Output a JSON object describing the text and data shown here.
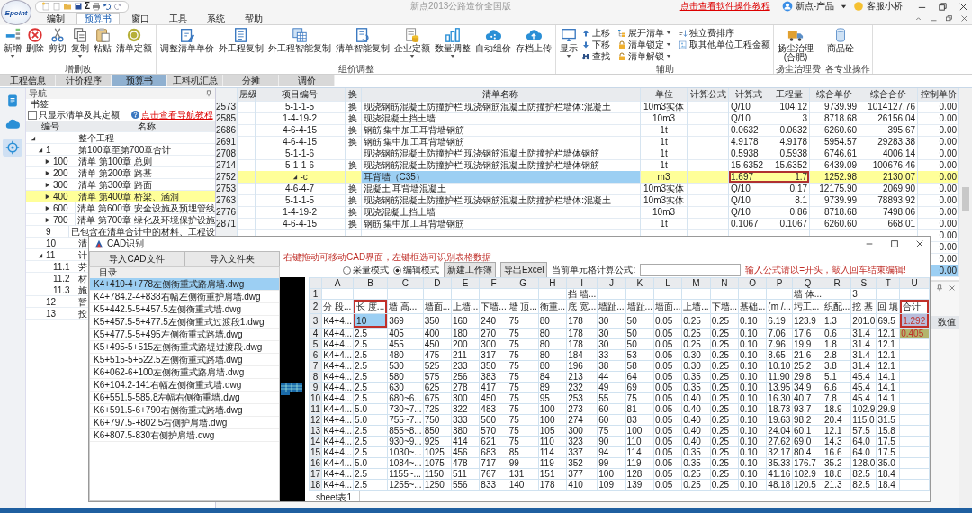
{
  "app": {
    "logo": "Epoint",
    "sum_symbol": "Σ",
    "title": "新点2013公路造价全国版",
    "tutorial_link": "点击查看软件操作教程",
    "user": "新点-产品",
    "support": "客服小桥"
  },
  "menu_tabs": [
    {
      "label": "编制",
      "selected": false
    },
    {
      "label": "预算书",
      "selected": true
    },
    {
      "label": "窗口",
      "selected": false
    },
    {
      "label": "工具",
      "selected": false
    },
    {
      "label": "系统",
      "selected": false
    },
    {
      "label": "帮助",
      "selected": false
    }
  ],
  "ribbon": [
    {
      "label": "增删改",
      "items": [
        {
          "kind": "large",
          "label": "新增",
          "dropdown": true
        },
        {
          "kind": "large",
          "label": "删除",
          "dropdown": false
        },
        {
          "kind": "large",
          "label": "剪切",
          "dropdown": false
        },
        {
          "kind": "large",
          "label": "复制",
          "dropdown": true
        },
        {
          "kind": "large",
          "label": "粘贴",
          "dropdown": false
        },
        {
          "kind": "large",
          "label": "清单定额",
          "dropdown": false
        }
      ]
    },
    {
      "label": "组价调整",
      "items": [
        {
          "kind": "large",
          "label": "调整清单单价",
          "dropdown": false
        },
        {
          "kind": "large",
          "label": "外工程复制",
          "dropdown": false
        },
        {
          "kind": "large",
          "label": "外工程智能复制",
          "dropdown": false
        },
        {
          "kind": "large",
          "label": "清单智能复制",
          "dropdown": false
        },
        {
          "kind": "large",
          "label": "企业定额",
          "dropdown": true
        },
        {
          "kind": "large",
          "label": "数量调整",
          "dropdown": true
        },
        {
          "kind": "large",
          "label": "自动组价",
          "dropdown": false
        },
        {
          "kind": "large",
          "label": "存档上传",
          "dropdown": false
        }
      ]
    },
    {
      "label": "辅助",
      "items": [
        {
          "kind": "large",
          "label": "显示",
          "dropdown": true
        },
        {
          "kind": "small",
          "label": "上移",
          "dropdown": false
        },
        {
          "kind": "small",
          "label": "下移",
          "dropdown": false
        },
        {
          "kind": "small",
          "label": "查找",
          "dropdown": false
        },
        {
          "kind": "small",
          "label": "展开清单",
          "dropdown": true
        },
        {
          "kind": "small",
          "label": "清单锁定",
          "dropdown": true
        },
        {
          "kind": "small",
          "label": "清单解锁",
          "dropdown": true
        },
        {
          "kind": "small",
          "label": "独立费排序",
          "dropdown": false
        },
        {
          "kind": "small",
          "label": "取其他单位工程金额",
          "dropdown": false
        }
      ]
    },
    {
      "label": "扬尘治理费",
      "items": [
        {
          "kind": "large",
          "label": "扬尘治理\n(合肥)",
          "dropdown": false
        }
      ]
    },
    {
      "label": "各专业操作",
      "items": [
        {
          "kind": "large",
          "label": "商品砼",
          "dropdown": false
        }
      ]
    }
  ],
  "page_tabs": [
    {
      "label": "工程信息",
      "selected": false
    },
    {
      "label": "计价程序",
      "selected": false
    },
    {
      "label": "预算书",
      "selected": true
    },
    {
      "label": "工料机汇总",
      "selected": false
    },
    {
      "label": "分摊",
      "selected": false
    },
    {
      "label": "调价",
      "selected": false
    }
  ],
  "side_nav": [
    {
      "selected": false
    },
    {
      "selected": false
    },
    {
      "selected": true
    }
  ],
  "nav": {
    "title": "导航",
    "bookmark": "书签",
    "filter": {
      "label": "只显示清单及其定额",
      "checked": false
    },
    "help_link": "点击查看导航教程",
    "columns": [
      "编号",
      "名称"
    ],
    "tree": [
      {
        "name": "整个工程",
        "expanded": true,
        "selected": false,
        "children": [
          {
            "code": "1",
            "name": "第100章至第700章合计",
            "expanded": true,
            "selected": false,
            "children": [
              {
                "code": "100",
                "name": "清单 第100章 总则",
                "expanded": false,
                "selected": false
              },
              {
                "code": "200",
                "name": "清单 第200章 路基",
                "expanded": false,
                "selected": false
              },
              {
                "code": "300",
                "name": "清单 第300章 路面",
                "expanded": false,
                "selected": false
              },
              {
                "code": "400",
                "name": "清单 第400章 桥梁、涵洞",
                "expanded": false,
                "selected": true
              },
              {
                "code": "600",
                "name": "清单 第600章 安全设施及预埋管线",
                "expanded": false,
                "selected": false
              },
              {
                "code": "700",
                "name": "清单 第700章 绿化及环境保护设施",
                "expanded": false,
                "selected": false
              }
            ]
          },
          {
            "code": "9",
            "name": "已包含在清单合计中的材料、工程设",
            "selected": false
          },
          {
            "code": "10",
            "name": "清",
            "selected": false
          },
          {
            "code": "11",
            "name": "计",
            "expanded": true,
            "selected": false,
            "children": [
              {
                "code": "11.1",
                "name": "劳",
                "selected": false
              },
              {
                "code": "11.2",
                "name": "材",
                "selected": false
              },
              {
                "code": "11.3",
                "name": "施",
                "selected": false
              }
            ]
          },
          {
            "code": "12",
            "name": "暂",
            "selected": false
          },
          {
            "code": "13",
            "name": "投",
            "selected": false
          }
        ]
      }
    ]
  },
  "table": {
    "columns": [
      "层级",
      "项目编号",
      "换",
      "清单名称",
      "单位",
      "计算公式",
      "计算式",
      "工程量",
      "综合单价",
      "综合合价",
      "控制单价"
    ],
    "rows": [
      {
        "num": "2573",
        "kind": "quota",
        "code": "5-1-1-5",
        "swap": "换",
        "name": "现浇钢筋混凝土防撞护栏 现浇钢筋混凝土防撞护栏墙体:混凝土",
        "unit": "10m3实体",
        "calc": "Q/10",
        "qty": "104.12",
        "price": "9739.99",
        "total": "1014127.76",
        "control": "0.00",
        "selected": false
      },
      {
        "num": "2585",
        "kind": "quota",
        "code": "1-4-19-2",
        "swap": "换",
        "name": "现浇混凝土挡土墙",
        "unit": "10m3",
        "calc": "Q/10",
        "qty": "3",
        "price": "8718.68",
        "total": "26156.04",
        "control": "0.00",
        "selected": false
      },
      {
        "num": "2686",
        "kind": "quota",
        "code": "4-6-4-15",
        "swap": "换",
        "name": "钢筋 集中加工耳背墙钢筋",
        "unit": "1t",
        "calc": "0.0632",
        "qty": "0.0632",
        "price": "6260.60",
        "total": "395.67",
        "control": "0.00",
        "selected": false
      },
      {
        "num": "2691",
        "kind": "quota",
        "code": "4-6-4-15",
        "swap": "换",
        "name": "钢筋 集中加工耳背墙钢筋",
        "unit": "1t",
        "calc": "4.9178",
        "qty": "4.9178",
        "price": "5954.57",
        "total": "29283.38",
        "control": "0.00",
        "selected": false
      },
      {
        "num": "2708",
        "kind": "quota",
        "code": "5-1-1-6",
        "name": "现浇钢筋混凝土防撞护栏 现浇钢筋混凝土防撞护栏墙体钢筋",
        "unit": "1t",
        "calc": "0.5938",
        "qty": "0.5938",
        "price": "6746.61",
        "total": "4006.14",
        "control": "0.00",
        "selected": false
      },
      {
        "num": "2714",
        "kind": "quota",
        "code": "5-1-1-6",
        "swap": "换",
        "name": "现浇钢筋混凝土防撞护栏 现浇钢筋混凝土防撞护栏墙体钢筋",
        "unit": "1t",
        "calc": "15.6352",
        "qty": "15.6352",
        "price": "6439.09",
        "total": "100676.46",
        "control": "0.00",
        "selected": false
      },
      {
        "num": "2752",
        "kind": "bill",
        "expanded": true,
        "flagged": true,
        "code": "-c",
        "name": "耳背墙（C35）",
        "unit": "m3",
        "calc": "1.697",
        "qty": "1.7",
        "price": "1252.98",
        "total": "2130.07",
        "control": "0.00",
        "selected": true
      },
      {
        "num": "2753",
        "kind": "quota",
        "code": "4-6-4-7",
        "swap": "换",
        "name": "混凝土 耳背墙混凝土",
        "unit": "10m3实体",
        "calc": "Q/10",
        "qty": "0.17",
        "price": "12175.90",
        "total": "2069.90",
        "control": "0.00",
        "selected": false
      },
      {
        "num": "2763",
        "kind": "quota",
        "code": "5-1-1-5",
        "swap": "换",
        "name": "现浇钢筋混凝土防撞护栏 现浇钢筋混凝土防撞护栏墙体:混凝土",
        "unit": "10m3实体",
        "calc": "Q/10",
        "qty": "8.1",
        "price": "9739.99",
        "total": "78893.92",
        "control": "0.00",
        "selected": false
      },
      {
        "num": "2776",
        "kind": "quota",
        "code": "1-4-19-2",
        "swap": "换",
        "name": "现浇混凝土挡土墙",
        "unit": "10m3",
        "calc": "Q/10",
        "qty": "0.86",
        "price": "8718.68",
        "total": "7498.06",
        "control": "0.00",
        "selected": false
      },
      {
        "num": "2871",
        "kind": "quota",
        "code": "4-6-4-15",
        "swap": "换",
        "name": "钢筋 集中加工耳背墙钢筋",
        "unit": "1t",
        "calc": "0.1067",
        "qty": "0.1067",
        "price": "6260.60",
        "total": "668.01",
        "control": "0.00",
        "selected": false
      },
      {
        "kind": "quota",
        "control": "0.00",
        "selected": false
      },
      {
        "kind": "quota",
        "control": "0.00",
        "selected": false
      },
      {
        "kind": "quota",
        "control": "0.00",
        "selected": false
      },
      {
        "kind": "quota",
        "control": "0.00",
        "selected": true
      }
    ]
  },
  "props_panel": {
    "column": "数值"
  },
  "cad_dialog": {
    "title": "CAD识别",
    "import_buttons": [
      "导入CAD文件",
      "导入文件夹"
    ],
    "hint": "右键拖动可移动CAD界面，左键框选可识别表格数据",
    "modes": [
      {
        "label": "采量模式",
        "selected": false
      },
      {
        "label": "编辑模式",
        "selected": true
      }
    ],
    "actions": [
      "新建工作簿",
      "导出Excel"
    ],
    "formula_label": "当前单元格计算公式:",
    "formula_hint": "输入公式请以=开头，敲入回车结束编辑!",
    "files_header": "目录",
    "files": [
      {
        "name": "K4+410-4+778左侧衡重式路肩墙.dwg",
        "selected": true
      },
      {
        "name": "K4+784.2-4+838右幅左侧衡重护肩墙.dwg",
        "selected": false
      },
      {
        "name": "K5+442.5-5+457.5左侧衡重式墙.dwg",
        "selected": false
      },
      {
        "name": "K5+457.5-5+477.5左侧衡重式过渡段1.dwg",
        "selected": false
      },
      {
        "name": "K5+477.5-5+495左侧衡重式路墙.dwg",
        "selected": false
      },
      {
        "name": "K5+495-5+515左侧衡重式路堤过渡段.dwg",
        "selected": false
      },
      {
        "name": "K5+515-5+522.5左侧衡重式路墙.dwg",
        "selected": false
      },
      {
        "name": "K6+062-6+100左侧衡重式路肩墙.dwg",
        "selected": false
      },
      {
        "name": "K6+104.2-141右幅左侧衡重式墙.dwg",
        "selected": false
      },
      {
        "name": "K6+551.5-585.8左幅右侧衡重墙.dwg",
        "selected": false
      },
      {
        "name": "K6+591.5-6+790右侧衡重式路墙.dwg",
        "selected": false
      },
      {
        "name": "K6+797.5-+802.5右侧护肩墙.dwg",
        "selected": false
      },
      {
        "name": "K6+807.5-830右侧护肩墙.dwg",
        "selected": false
      }
    ],
    "sheet": {
      "columns": [
        "A",
        "B",
        "C",
        "D",
        "E",
        "F",
        "G",
        "H",
        "I",
        "J",
        "K",
        "L",
        "M",
        "N",
        "O",
        "P",
        "Q",
        "R",
        "S",
        "T",
        "U"
      ],
      "rows": [
        {
          "num": "1",
          "cells": {
            "I": "挡 墙...",
            "Q": "墙 体...",
            "S": "3"
          }
        },
        {
          "num": "2",
          "cells": [
            "分 段...",
            {
              "text": "长 度...",
              "outlined": true
            },
            "墙 高...",
            "墙面...",
            "上墙...",
            "下墙...",
            "墙 顶...",
            "衡重...",
            "底 宽...",
            "墙趾...",
            "墙趾...",
            "墙面...",
            "上墙...",
            "下墙...",
            "基础...",
            "(m /...",
            "圬工...",
            "织配...",
            "挖 基",
            "回 填",
            {
              "text": "合计",
              "outlined": true
            }
          ]
        },
        {
          "num": "3",
          "cells": [
            "K4+4...",
            {
              "text": "10",
              "active": true,
              "outlined": true
            },
            "369",
            "350",
            "160",
            "240",
            "75",
            "80",
            "178",
            "30",
            "50",
            "0.05",
            "0.25",
            "0.25",
            "0.10",
            "6.19",
            "123.9",
            "1.3",
            "201.0",
            "69.5",
            {
              "text": "1.292",
              "color": "#b9bddb",
              "outlined": true
            }
          ]
        },
        {
          "num": "4",
          "cells": [
            "K4+4...",
            "2.5",
            "405",
            "400",
            "180",
            "270",
            "75",
            "80",
            "178",
            "30",
            "50",
            "0.05",
            "0.25",
            "0.25",
            "0.10",
            "7.06",
            "17.6",
            "0.6",
            "31.4",
            "12.1",
            {
              "text": "0.405",
              "color": "#b3b46c"
            }
          ]
        },
        {
          "num": "5",
          "cells": [
            "K4+4...",
            "2.5",
            "455",
            "450",
            "200",
            "300",
            "75",
            "80",
            "178",
            "30",
            "50",
            "0.05",
            "0.25",
            "0.25",
            "0.10",
            "7.96",
            "19.9",
            "1.8",
            "31.4",
            "12.1"
          ]
        },
        {
          "num": "6",
          "cells": [
            "K4+4...",
            "2.5",
            "480",
            "475",
            "211",
            "317",
            "75",
            "80",
            "184",
            "33",
            "53",
            "0.05",
            "0.30",
            "0.25",
            "0.10",
            "8.65",
            "21.6",
            "2.8",
            "31.4",
            "12.1"
          ]
        },
        {
          "num": "7",
          "cells": [
            "K4+4...",
            "2.5",
            "530",
            "525",
            "233",
            "350",
            "75",
            "80",
            "196",
            "38",
            "58",
            "0.05",
            "0.30",
            "0.25",
            "0.10",
            "10.10",
            "25.2",
            "3.8",
            "31.4",
            "12.1"
          ]
        },
        {
          "num": "8",
          "cells": [
            "K4+4...",
            "2.5",
            "580",
            "575",
            "256",
            "383",
            "75",
            "84",
            "213",
            "44",
            "64",
            "0.05",
            "0.35",
            "0.25",
            "0.10",
            "11.90",
            "29.8",
            "5.1",
            "45.4",
            "14.1"
          ]
        },
        {
          "num": "9",
          "cells": [
            "K4+4...",
            "2.5",
            "630",
            "625",
            "278",
            "417",
            "75",
            "89",
            "232",
            "49",
            "69",
            "0.05",
            "0.35",
            "0.25",
            "0.10",
            "13.95",
            "34.9",
            "6.6",
            "45.4",
            "14.1"
          ]
        },
        {
          "num": "10",
          "cells": [
            "K4+4...",
            "2.5",
            "680~6...",
            "675",
            "300",
            "450",
            "75",
            "95",
            "253",
            "55",
            "75",
            "0.05",
            "0.40",
            "0.25",
            "0.10",
            "16.30",
            "40.7",
            "7.8",
            "45.4",
            "14.1"
          ]
        },
        {
          "num": "11",
          "cells": [
            "K4+4...",
            "5.0",
            "730~7...",
            "725",
            "322",
            "483",
            "75",
            "100",
            "273",
            "60",
            "81",
            "0.05",
            "0.40",
            "0.25",
            "0.10",
            "18.73",
            "93.7",
            "18.9",
            "102.9",
            "29.9"
          ]
        },
        {
          "num": "12",
          "cells": [
            "K4+4...",
            "5.0",
            "755~7...",
            "750",
            "333",
            "500",
            "75",
            "100",
            "274",
            "60",
            "83",
            "0.05",
            "0.40",
            "0.25",
            "0.10",
            "19.63",
            "98.2",
            "20.4",
            "115.0",
            "31.5"
          ]
        },
        {
          "num": "13",
          "cells": [
            "K4+4...",
            "2.5",
            "855~8...",
            "850",
            "380",
            "570",
            "75",
            "105",
            "300",
            "75",
            "100",
            "0.05",
            "0.40",
            "0.25",
            "0.10",
            "24.04",
            "60.1",
            "12.1",
            "57.5",
            "15.8"
          ]
        },
        {
          "num": "14",
          "cells": [
            "K4+4...",
            "2.5",
            "930~9...",
            "925",
            "414",
            "621",
            "75",
            "110",
            "323",
            "90",
            "110",
            "0.05",
            "0.40",
            "0.25",
            "0.10",
            "27.62",
            "69.0",
            "14.3",
            "64.0",
            "17.5"
          ]
        },
        {
          "num": "15",
          "cells": [
            "K4+4...",
            "2.5",
            "1030~...",
            "1025",
            "456",
            "683",
            "85",
            "114",
            "337",
            "94",
            "114",
            "0.05",
            "0.35",
            "0.25",
            "0.10",
            "32.17",
            "80.4",
            "16.6",
            "64.0",
            "17.5"
          ]
        },
        {
          "num": "16",
          "cells": [
            "K4+4...",
            "5.0",
            "1084~...",
            "1075",
            "478",
            "717",
            "99",
            "119",
            "352",
            "99",
            "119",
            "0.05",
            "0.35",
            "0.25",
            "0.10",
            "35.33",
            "176.7",
            "35.2",
            "128.0",
            "35.0"
          ]
        },
        {
          "num": "17",
          "cells": [
            "K4+4...",
            "2.5",
            "1155~...",
            "1150",
            "511",
            "767",
            "131",
            "151",
            "377",
            "100",
            "128",
            "0.05",
            "0.25",
            "0.25",
            "0.10",
            "41.16",
            "102.9",
            "18.8",
            "82.5",
            "18.4"
          ]
        },
        {
          "num": "18",
          "cells": [
            "K4+4...",
            "2.5",
            "1255~...",
            "1250",
            "556",
            "833",
            "140",
            "178",
            "410",
            "109",
            "139",
            "0.05",
            "0.25",
            "0.25",
            "0.10",
            "48.18",
            "120.5",
            "21.3",
            "82.5",
            "18.4"
          ]
        }
      ]
    },
    "sheet_tab": "sheet表1"
  }
}
